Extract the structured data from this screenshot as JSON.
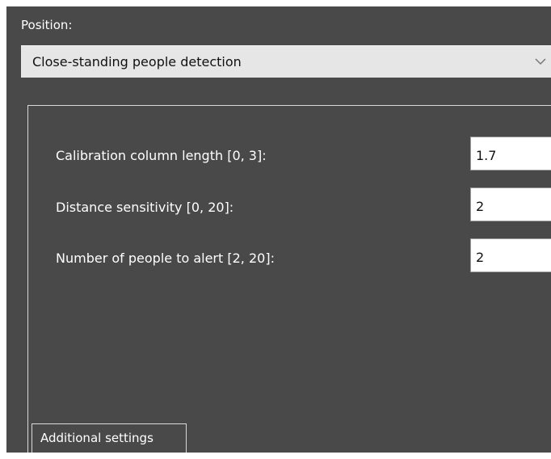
{
  "position": {
    "label": "Position:",
    "selected_value": "Close-standing people detection",
    "dropdown_icon": "chevron-down-icon"
  },
  "settings": {
    "calibration_label": "Calibration column length [0, 3]:",
    "calibration_value": "1.7",
    "distance_label": "Distance sensitivity [0, 20]:",
    "distance_value": "2",
    "people_label": "Number of people to alert [2, 20]:",
    "people_value": "2"
  },
  "tabs": {
    "additional_settings": "Additional settings"
  }
}
